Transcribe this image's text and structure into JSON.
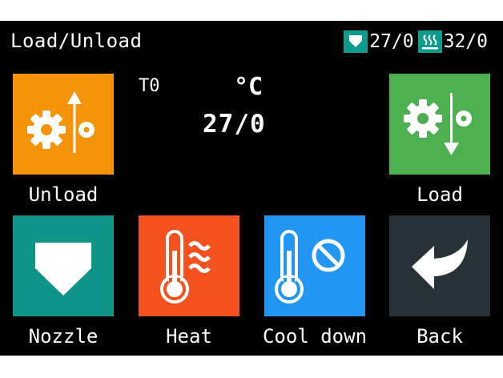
{
  "header": {
    "title": "Load/Unload",
    "nozzle_temp": "27/0",
    "bed_temp": "32/0",
    "nozzle_icon": "nozzle-down-arrow-icon",
    "bed_icon": "heated-bed-icon"
  },
  "temperature": {
    "tool": "T0",
    "unit": "°C",
    "value": "27/0"
  },
  "buttons": {
    "unload": {
      "label": "Unload",
      "color": "#f5930b",
      "icon": "gear-unload-up-icon"
    },
    "load": {
      "label": "Load",
      "color": "#4caf50",
      "icon": "gear-load-down-icon"
    },
    "nozzle": {
      "label": "Nozzle",
      "color": "#0e9488",
      "icon": "nozzle-icon"
    },
    "heat": {
      "label": "Heat",
      "color": "#f4511e",
      "icon": "thermometer-heat-icon"
    },
    "cooldown": {
      "label": "Cool down",
      "color": "#2196f3",
      "icon": "thermometer-off-icon"
    },
    "back": {
      "label": "Back",
      "color": "#263238",
      "icon": "back-arrow-icon"
    }
  },
  "colors": {
    "background": "#000000",
    "text": "#ffffff",
    "status_icon_bg": "#0e9c8f"
  }
}
